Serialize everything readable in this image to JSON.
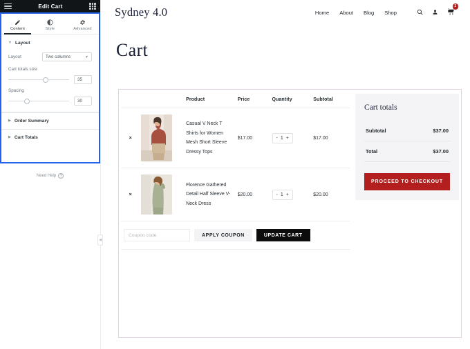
{
  "panel": {
    "title": "Edit Cart",
    "menu_icon": "hamburger-icon",
    "apps_icon": "grid-icon",
    "tabs": [
      {
        "label": "Content",
        "icon": "pencil-icon",
        "active": true
      },
      {
        "label": "Style",
        "icon": "contrast-circle-icon",
        "active": false
      },
      {
        "label": "Advanced",
        "icon": "gear-icon",
        "active": false
      }
    ],
    "sections": {
      "layout": {
        "heading": "Layout",
        "layout_label": "Layout",
        "layout_value": "Two columns",
        "cart_totals_size_label": "Cart totals size",
        "cart_totals_size_value": "35",
        "spacing_label": "Spacing",
        "spacing_value": "30"
      }
    },
    "accordions": [
      {
        "label": "Order Summary"
      },
      {
        "label": "Cart Totals"
      }
    ],
    "need_help": "Need Help",
    "need_help_icon": "question-circle-icon",
    "collapse_icon": "chevron-left-icon"
  },
  "site": {
    "logo": "Sydney 4.0",
    "nav": [
      {
        "label": "Home"
      },
      {
        "label": "About"
      },
      {
        "label": "Blog"
      },
      {
        "label": "Shop"
      }
    ],
    "icons": [
      {
        "name": "search-icon"
      },
      {
        "name": "user-icon"
      },
      {
        "name": "cart-icon"
      }
    ],
    "cart_count": "2",
    "page_title": "Cart"
  },
  "cart": {
    "columns": [
      "",
      "",
      "Product",
      "Price",
      "Quantity",
      "Subtotal"
    ],
    "headers": {
      "product": "Product",
      "price": "Price",
      "quantity": "Quantity",
      "subtotal": "Subtotal"
    },
    "remove_label": "×",
    "items": [
      {
        "name": "Casual V Neck T Shirts for Women Mesh Short Sleeve Dressy Tops",
        "price": "$17.00",
        "qty": "1",
        "subtotal": "$17.00",
        "minus": "-",
        "plus": "+"
      },
      {
        "name": "Florence Gathered Detail Half Sleeve V-Neck Dress",
        "price": "$20.00",
        "qty": "1",
        "subtotal": "$20.00",
        "minus": "-",
        "plus": "+"
      }
    ],
    "coupon_placeholder": "Coupon code",
    "coupon_value": "",
    "apply_coupon_label": "APPLY COUPON",
    "update_cart_label": "UPDATE CART"
  },
  "totals": {
    "title": "Cart totals",
    "rows": [
      {
        "label": "Subtotal",
        "value": "$37.00"
      },
      {
        "label": "Total",
        "value": "$37.00"
      }
    ],
    "checkout_label": "PROCEED TO CHECKOUT"
  },
  "colors": {
    "panel_header_bg": "#111518",
    "selection_blue": "#2563eb",
    "widget_outline": "#e8cfe0",
    "accent_red": "#b31f1f",
    "dark_button": "#0c0c0c",
    "totals_bg": "#f4f4f6",
    "logo_navy": "#1b2037"
  }
}
